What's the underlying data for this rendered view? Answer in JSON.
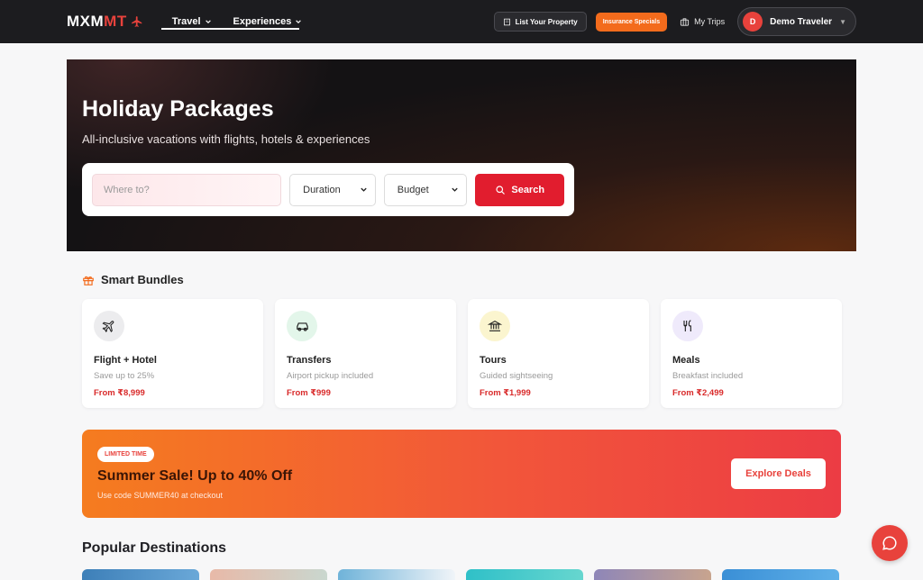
{
  "nav": {
    "logo_main": "MXM",
    "logo_accent": "MT",
    "links": [
      {
        "label": "Travel"
      },
      {
        "label": "Experiences"
      }
    ],
    "list_property": "List Your Property",
    "specials": "Insurance Specials",
    "my_trips": "My Trips",
    "user_initial": "D",
    "user_name": "Demo Traveler"
  },
  "hero": {
    "title": "Holiday Packages",
    "subtitle": "All-inclusive vacations with flights, hotels & experiences",
    "search": {
      "placeholder": "Where to?",
      "duration": "Duration",
      "budget": "Budget",
      "button": "Search"
    }
  },
  "bundles": {
    "heading": "Smart Bundles",
    "items": [
      {
        "title": "Flight + Hotel",
        "subtitle": "Save up to 25%",
        "price": "From ₹8,999",
        "icon": "plane-icon",
        "icon_bg": "#ececee"
      },
      {
        "title": "Transfers",
        "subtitle": "Airport pickup included",
        "price": "From ₹999",
        "icon": "car-icon",
        "icon_bg": "#e3f6ea"
      },
      {
        "title": "Tours",
        "subtitle": "Guided sightseeing",
        "price": "From ₹1,999",
        "icon": "landmark-icon",
        "icon_bg": "#fbf5cf"
      },
      {
        "title": "Meals",
        "subtitle": "Breakfast included",
        "price": "From ₹2,499",
        "icon": "utensils-icon",
        "icon_bg": "#efeafb"
      }
    ]
  },
  "promo": {
    "badge": "LIMITED TIME",
    "title": "Summer Sale! Up to 40% Off",
    "subtitle": "Use code SUMMER40 at checkout",
    "button": "Explore Deals"
  },
  "popular": {
    "heading": "Popular Destinations"
  },
  "colors": {
    "brand_red": "#e11d2e",
    "accent_orange": "#f36b1c",
    "nav_bg": "#1c1c1f"
  }
}
